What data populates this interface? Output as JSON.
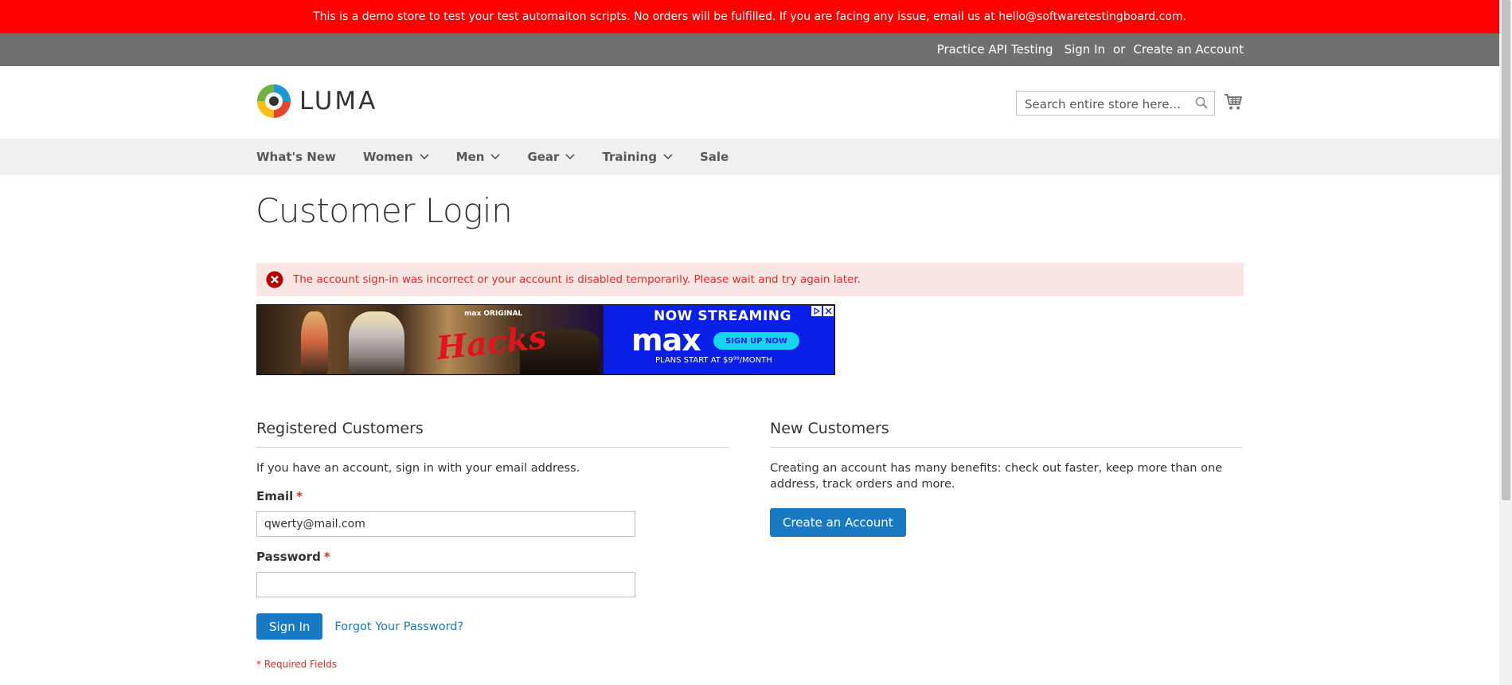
{
  "demo_banner": {
    "text": "This is a demo store to test your test automaiton scripts. No orders will be fulfilled. If you are facing any issue, email us at hello@softwaretestingboard.com."
  },
  "panel": {
    "practice_api": "Practice API Testing",
    "sign_in": "Sign In",
    "or": "or",
    "create_account": "Create an Account"
  },
  "header": {
    "logo_text": "LUMA",
    "search_placeholder": "Search entire store here...",
    "search_icon": "search-icon",
    "cart_icon": "shopping-cart-icon"
  },
  "nav": {
    "items": [
      {
        "label": "What's New",
        "dropdown": false
      },
      {
        "label": "Women",
        "dropdown": true
      },
      {
        "label": "Men",
        "dropdown": true
      },
      {
        "label": "Gear",
        "dropdown": true
      },
      {
        "label": "Training",
        "dropdown": true
      },
      {
        "label": "Sale",
        "dropdown": false
      }
    ]
  },
  "page": {
    "title": "Customer Login"
  },
  "error": {
    "icon": "error-circle-x-icon",
    "text": "The account sign-in was incorrect or your account is disabled temporarily. Please wait and try again later."
  },
  "ad": {
    "max_original": "max ORIGINAL",
    "show_title": "Hacks",
    "now_streaming": "NOW STREAMING",
    "brand": "max",
    "cta": "SIGN UP NOW",
    "plans": "PLANS START AT $9⁹⁹/MONTH",
    "ad_choices_icon": "ad-choices-icon",
    "close_icon": "close-icon",
    "colors": {
      "background": "#0a1fe8",
      "cta": "#14d6ee",
      "title": "#e4131b"
    }
  },
  "registered": {
    "title": "Registered Customers",
    "intro": "If you have an account, sign in with your email address.",
    "email_label": "Email",
    "email_value": "qwerty@mail.com",
    "password_label": "Password",
    "password_value": "",
    "required_mark": "*",
    "sign_in_button": "Sign In",
    "forgot_link": "Forgot Your Password?",
    "required_note": "* Required Fields"
  },
  "new_customers": {
    "title": "New Customers",
    "text": "Creating an account has many benefits: check out faster, keep more than one address, track orders and more.",
    "button": "Create an Account"
  },
  "colors": {
    "banner": "#ff0000",
    "panel": "#6e716e",
    "nav": "#f0f0f0",
    "error_bg": "#fae5e5",
    "error_text": "#e02b27",
    "primary": "#1979c3"
  }
}
